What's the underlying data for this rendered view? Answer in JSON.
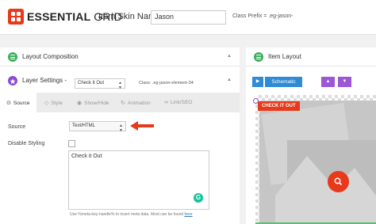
{
  "header": {
    "logo_bold": "ESSENTIAL",
    "logo_light": "GRID",
    "skin_name_label": "Item Skin Name:",
    "skin_name_value": "Jason",
    "class_prefix": "Class Prefix = .eg-jason-"
  },
  "layout_composition": {
    "title": "Layout Composition"
  },
  "layer_settings": {
    "title": "Layer Settings -",
    "layer_value": "Check it Out",
    "class_label": "Class: .eg-jason-element-34",
    "tabs": [
      {
        "label": "Source",
        "icon": "target-icon"
      },
      {
        "label": "Style",
        "icon": "droplet-icon"
      },
      {
        "label": "Show/Hide",
        "icon": "eye-icon"
      },
      {
        "label": "Animation",
        "icon": "refresh-icon"
      },
      {
        "label": "Link/SEO",
        "icon": "link-icon"
      }
    ],
    "active_tab": "Source",
    "source_label": "Source",
    "source_value": "Text/HTML",
    "disable_styling_label": "Disable Styling",
    "text_value": "Check it Out",
    "hint_text": "Use %meta-key-handle% to insert meta data. Most can be found",
    "hint_link": "here"
  },
  "item_layout": {
    "title": "Item Layout",
    "schematic_label": "Schematic",
    "tag_text": "CHECK IT OUT"
  },
  "colors": {
    "brand_red": "#e8391a",
    "green": "#3ab05a",
    "purple": "#8a4bd8",
    "blue": "#2f8bd5"
  }
}
